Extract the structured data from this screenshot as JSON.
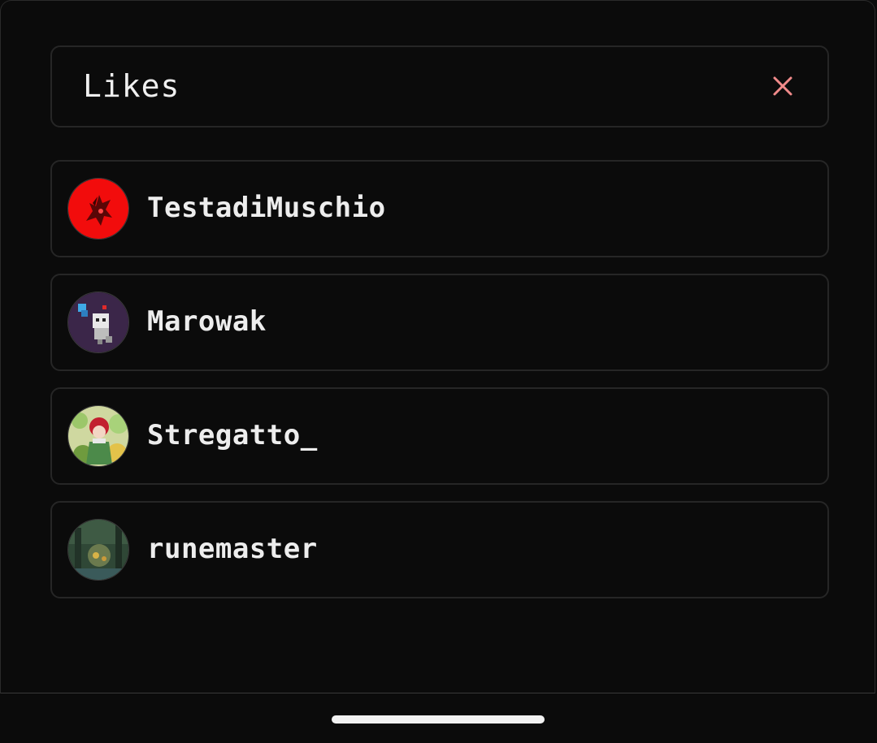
{
  "dialog": {
    "title": "Likes",
    "close_icon": "close-icon",
    "accent_color": "#f08a8a"
  },
  "users": [
    {
      "username": "TestadiMuschio",
      "avatar": "red-demon-avatar"
    },
    {
      "username": "Marowak",
      "avatar": "pixel-creature-avatar"
    },
    {
      "username": "Stregatto_",
      "avatar": "anime-girl-avatar"
    },
    {
      "username": "runemaster",
      "avatar": "forest-scene-avatar"
    }
  ],
  "system": {
    "home_indicator": "home-indicator"
  }
}
